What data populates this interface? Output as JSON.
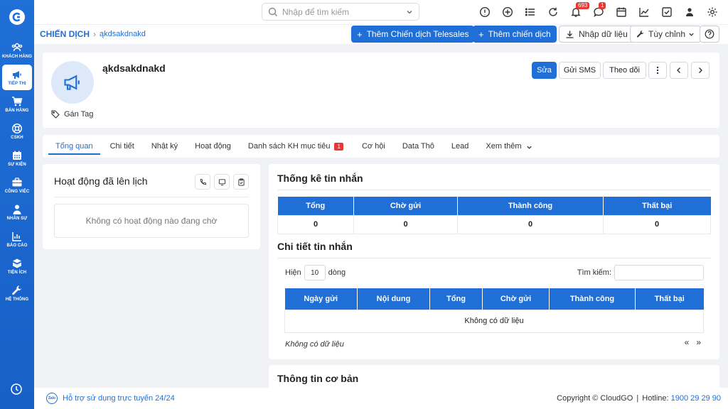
{
  "sidebar": {
    "items": [
      {
        "label": "KHÁCH HÀNG",
        "icon": "users-icon"
      },
      {
        "label": "TIẾP THỊ",
        "icon": "megaphone-icon",
        "active": true
      },
      {
        "label": "BÁN HÀNG",
        "icon": "cart-icon"
      },
      {
        "label": "CSKH",
        "icon": "support-icon"
      },
      {
        "label": "SỰ KIỆN",
        "icon": "calendar-icon"
      },
      {
        "label": "CÔNG VIỆC",
        "icon": "briefcase-icon"
      },
      {
        "label": "NHÂN SỰ",
        "icon": "person-icon"
      },
      {
        "label": "BÁO CÁO",
        "icon": "report-icon"
      },
      {
        "label": "TIỆN ÍCH",
        "icon": "utilities-icon"
      },
      {
        "label": "HỆ THỐNG",
        "icon": "wrench-icon"
      }
    ]
  },
  "topbar": {
    "search_placeholder": "Nhập để tìm kiếm",
    "notif_count": "693",
    "chat_count": "1"
  },
  "breadcrumb": {
    "module": "CHIẾN DỊCH",
    "record": "ąkdsakdnakd"
  },
  "actions": {
    "add_telesales": "Thêm Chiến dịch Telesales",
    "add_campaign": "Thêm chiến dịch",
    "import": "Nhập dữ liệu",
    "customize": "Tùy chỉnh"
  },
  "record": {
    "name": "ąkdsakdnakd",
    "tag_label": "Gán Tag",
    "edit": "Sửa",
    "send_sms": "Gửi SMS",
    "follow": "Theo dõi"
  },
  "tabs": [
    {
      "label": "Tổng quan",
      "active": true
    },
    {
      "label": "Chi tiết"
    },
    {
      "label": "Nhật ký"
    },
    {
      "label": "Hoạt động"
    },
    {
      "label": "Danh sách KH mục tiêu",
      "count": "1"
    },
    {
      "label": "Cơ hội"
    },
    {
      "label": "Data Thô"
    },
    {
      "label": "Lead"
    },
    {
      "label": "Xem thêm"
    }
  ],
  "scheduled": {
    "title": "Hoạt động đã lên lịch",
    "empty": "Không có hoạt động nào đang chờ"
  },
  "stats": {
    "title": "Thống kê tin nhắn",
    "headers": [
      "Tổng",
      "Chờ gửi",
      "Thành công",
      "Thất bại"
    ],
    "values": [
      "0",
      "0",
      "0",
      "0"
    ]
  },
  "details": {
    "title": "Chi tiết tin nhắn",
    "show_label": "Hiện",
    "rows_value": "10",
    "rows_label": "dòng",
    "search_label": "Tìm kiếm:",
    "headers": [
      "Ngày gửi",
      "Nội dung",
      "Tổng",
      "Chờ gửi",
      "Thành công",
      "Thất bại"
    ],
    "empty_row": "Không có dữ liệu",
    "empty_info": "Không có dữ liệu",
    "pager_prev": "«",
    "pager_next": "»"
  },
  "basic_info": {
    "title": "Thông tin cơ bản"
  },
  "footer": {
    "support": "Hỗ trợ sử dụng trực tuyến 24/24",
    "zalo": "Zalo",
    "copyright": "Copyright © CloudGO",
    "hotline_label": "Hotline:",
    "hotline_number": "1900 29 29 90"
  },
  "colors": {
    "primary": "#1f6fd6",
    "badge": "#e53935"
  }
}
